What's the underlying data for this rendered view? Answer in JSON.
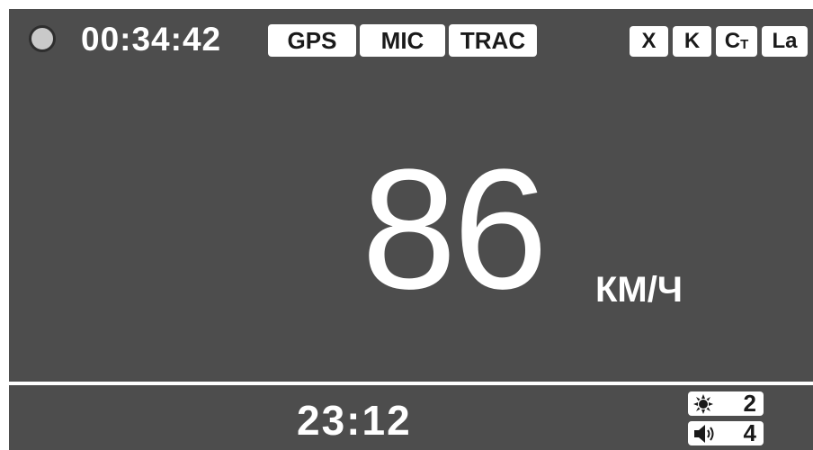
{
  "status": {
    "recording_timer": "00:34:42"
  },
  "left_badges": [
    "GPS",
    "MIC",
    "TRAC"
  ],
  "right_badges": {
    "x": "X",
    "k": "K",
    "ct_main": "C",
    "ct_sub": "T",
    "la": "La"
  },
  "speed": {
    "value": "86",
    "unit": "КМ/Ч"
  },
  "bottom": {
    "clock": "23:12",
    "brightness_value": "2",
    "volume_value": "4"
  },
  "icons": {
    "record": "record-indicator-icon",
    "brightness": "brightness-icon",
    "volume": "speaker-icon"
  },
  "colors": {
    "background": "#4d4d4d",
    "foreground": "#ffffff",
    "badge_text": "#1a1a1a",
    "record_dot": "#c9c9c9"
  }
}
